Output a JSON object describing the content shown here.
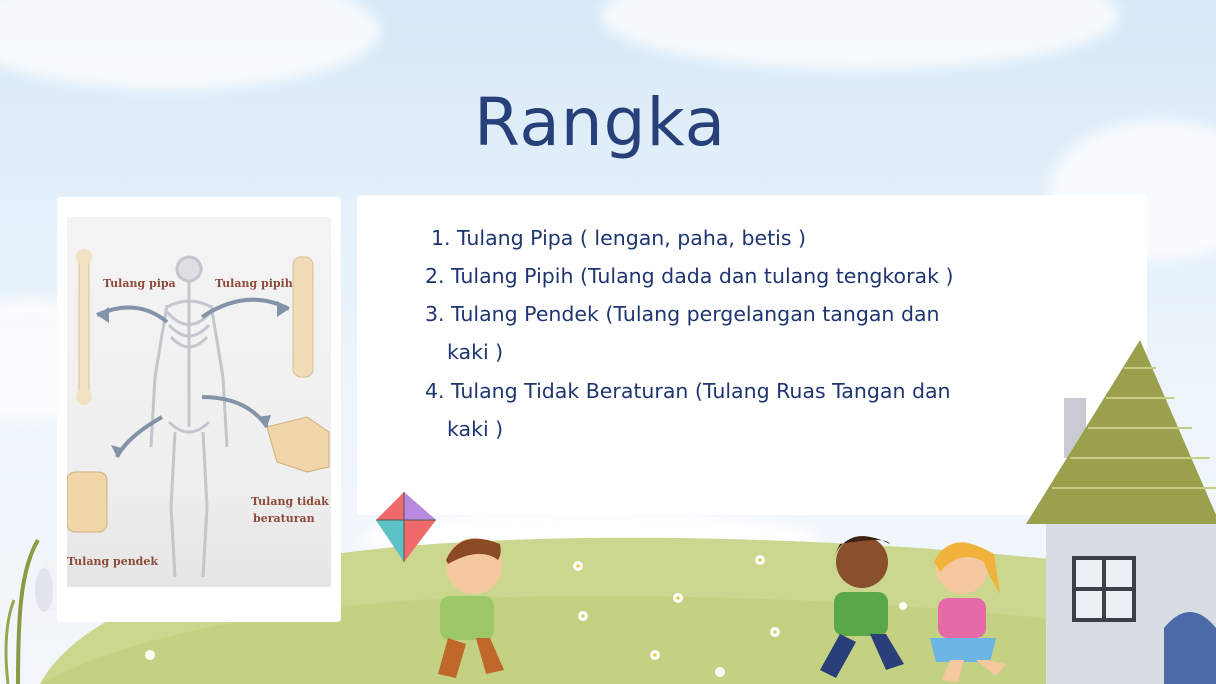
{
  "slide": {
    "title": "Rangka",
    "image_labels": {
      "pipa": "Tulang pipa",
      "pipih": "Tulang pipih",
      "tidak_line1": "Tulang tidak",
      "tidak_line2": "beraturan",
      "pendek": "Tulang pendek"
    },
    "items": [
      {
        "num": "1.",
        "text": "Tulang Pipa  ( lengan,  paha, betis )"
      },
      {
        "num": "2.",
        "text": "Tulang Pipih  (Tulang dada dan tulang tengkorak )"
      },
      {
        "num": "3.",
        "text": "Tulang Pendek  (Tulang pergelangan tangan dan",
        "cont": "kaki )"
      },
      {
        "num": "4.",
        "text": "Tulang Tidak Beraturan  (Tulang Ruas Tangan dan",
        "cont": "kaki )"
      }
    ],
    "colors": {
      "title": "#27407a",
      "text": "#1f3570",
      "grass": "#c9d58a",
      "roof": "#9aa04c",
      "house_wall": "#d8dde3"
    }
  }
}
